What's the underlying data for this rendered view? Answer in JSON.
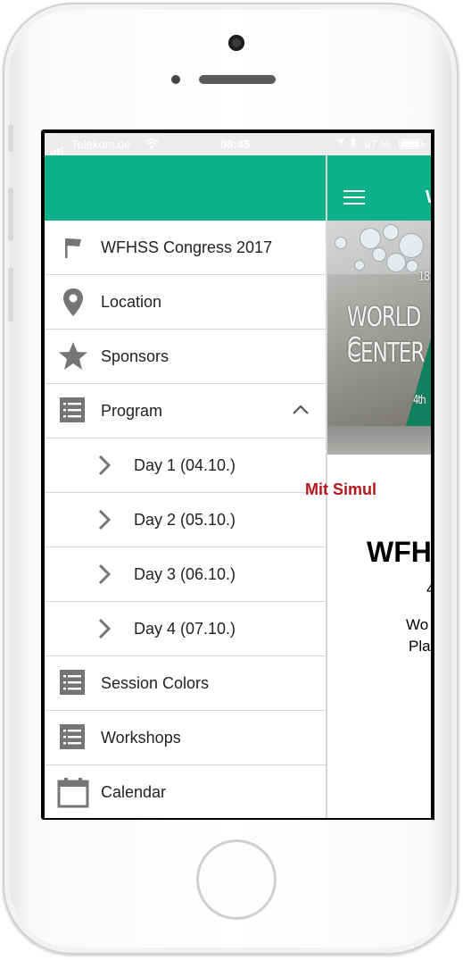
{
  "status_bar": {
    "carrier": "Telekom.de",
    "time": "08:45",
    "battery": "97 %"
  },
  "header": {
    "title_peek": "W"
  },
  "drawer": {
    "items": [
      {
        "label": "WFHSS Congress 2017",
        "icon": "flag-icon"
      },
      {
        "label": "Location",
        "icon": "map-pin-icon"
      },
      {
        "label": "Sponsors",
        "icon": "star-icon"
      },
      {
        "label": "Program",
        "icon": "list-icon",
        "expanded": true
      },
      {
        "label": "Day 1 (04.10.)",
        "icon": "chevron-right-icon"
      },
      {
        "label": "Day 2 (05.10.)",
        "icon": "chevron-right-icon"
      },
      {
        "label": "Day 3 (06.10.)",
        "icon": "chevron-right-icon"
      },
      {
        "label": "Day 4 (07.10.)",
        "icon": "chevron-right-icon"
      },
      {
        "label": "Session Colors",
        "icon": "list-icon"
      },
      {
        "label": "Workshops",
        "icon": "list-icon"
      },
      {
        "label": "Calendar",
        "icon": "calendar-icon"
      }
    ]
  },
  "main": {
    "photo_text": {
      "line1": "WORLD C",
      "line2": "CENTER",
      "line3": "18",
      "line4": "4th"
    },
    "red_text": "Mit Simul",
    "big_text": "WFH",
    "peek_lines": [
      "4",
      "Wo",
      "Pla"
    ]
  },
  "colors": {
    "accent": "#0eb08a",
    "red": "#b3171b",
    "icon_gray": "#757575"
  }
}
